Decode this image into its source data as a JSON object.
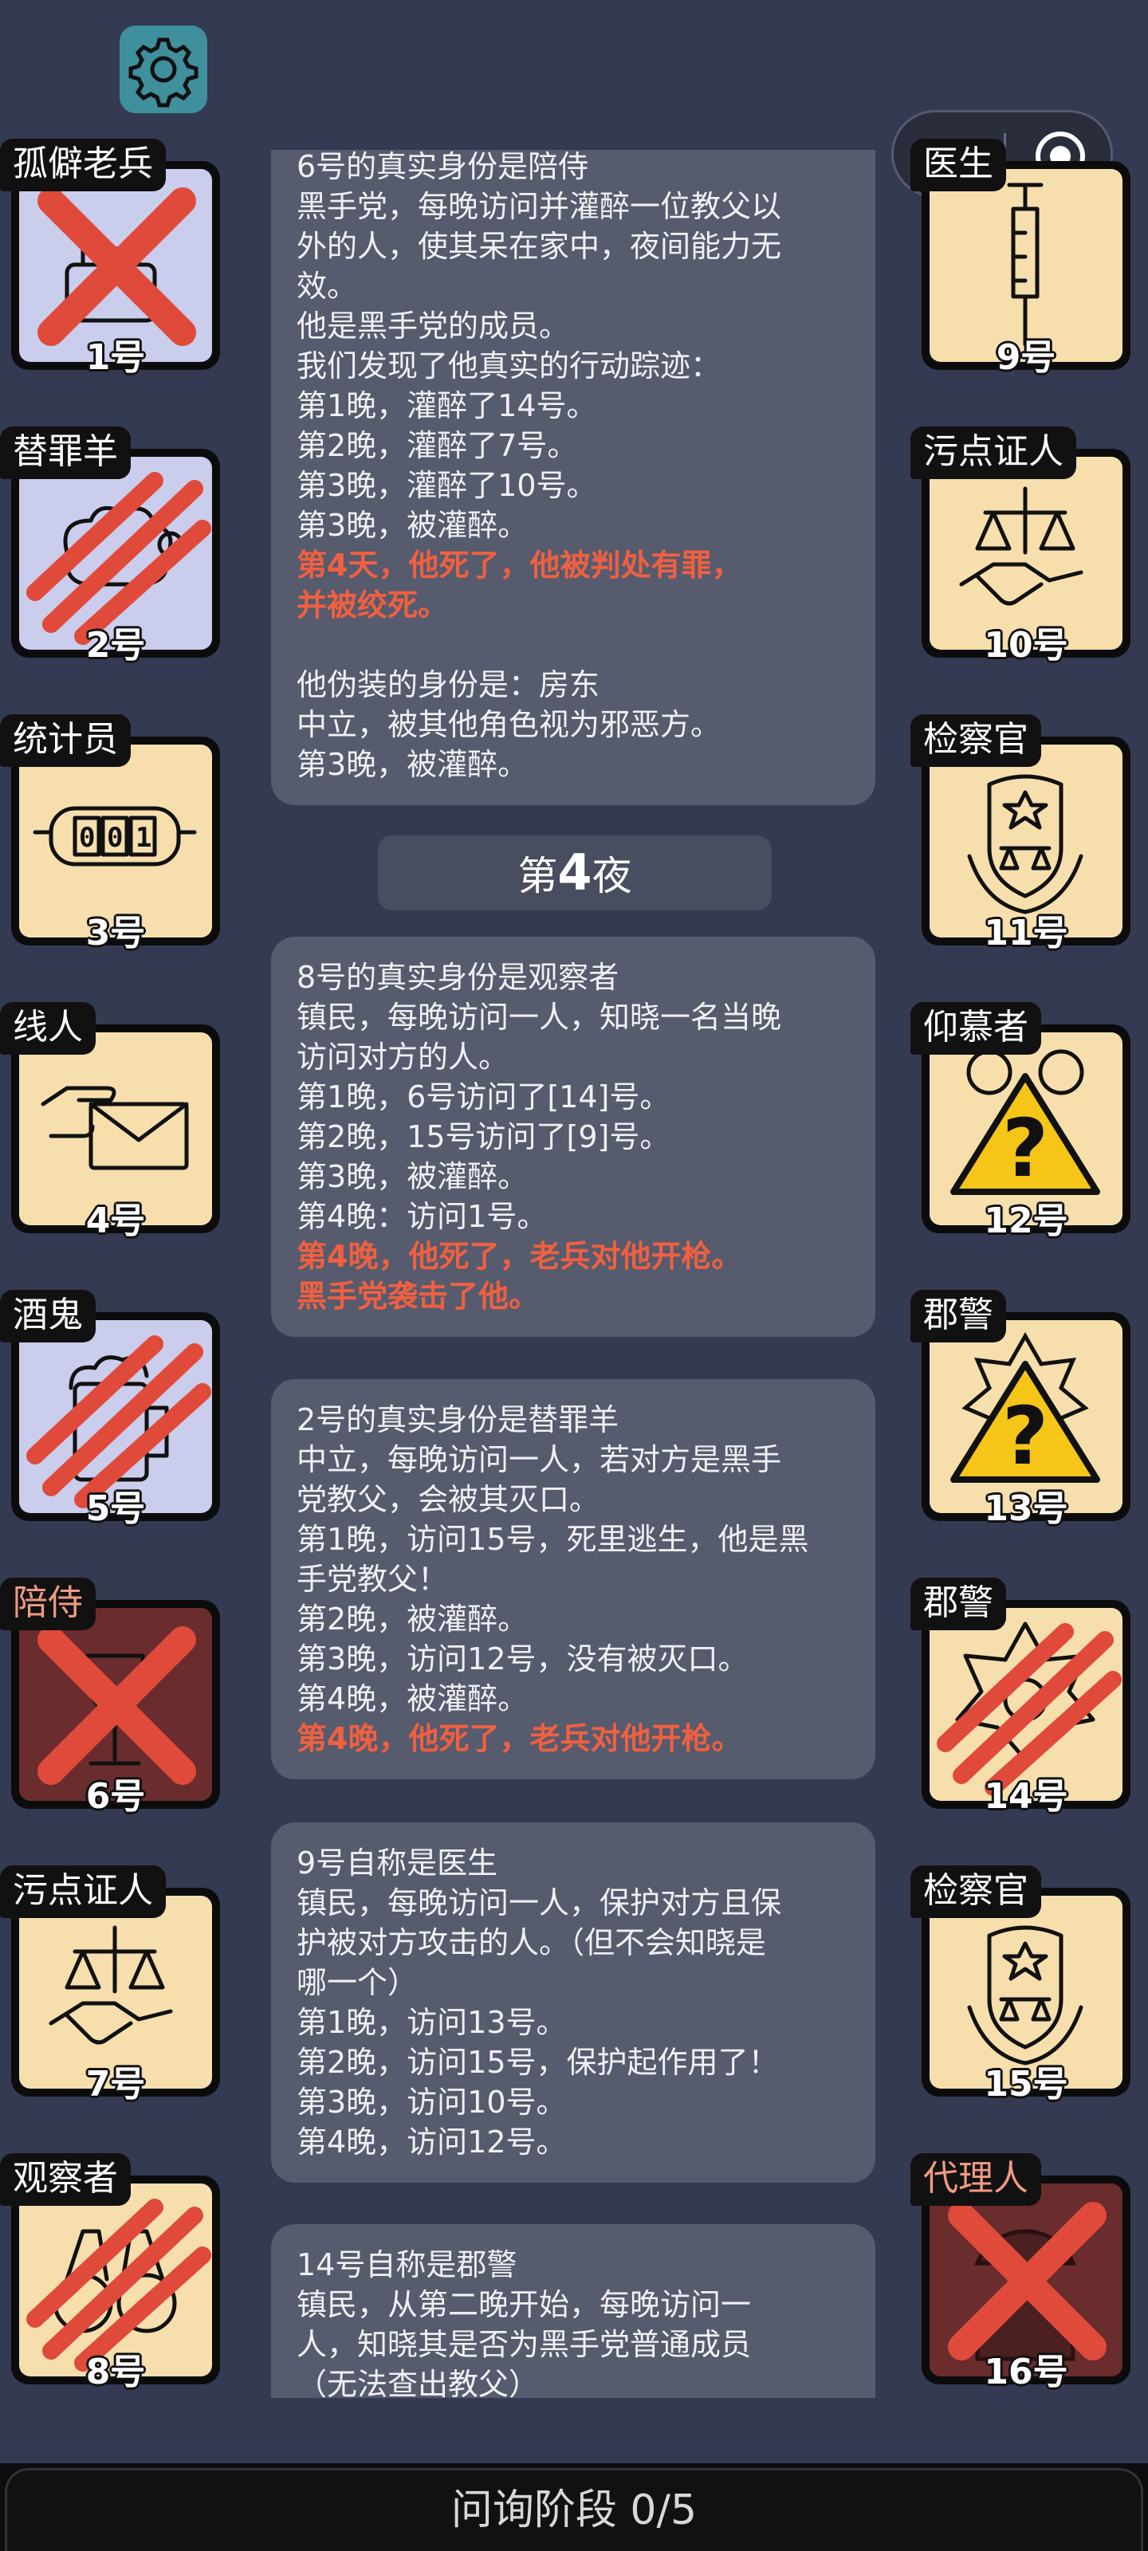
{
  "top": {
    "settings_icon": "gear-icon",
    "capsule": {
      "more_icon": "more-dots-icon",
      "close_icon": "target-icon"
    }
  },
  "players": [
    {
      "role": "孤僻老兵",
      "number": "1号",
      "icon": "veteran-icon",
      "bg": "lav",
      "mark": "x"
    },
    {
      "role": "替罪羊",
      "number": "2号",
      "icon": "sheep-icon",
      "bg": "lav",
      "mark": "claw"
    },
    {
      "role": "统计员",
      "number": "3号",
      "icon": "counter-icon",
      "bg": "yellow",
      "mark": "none"
    },
    {
      "role": "线人",
      "number": "4号",
      "icon": "envelope-hand-icon",
      "bg": "yellow",
      "mark": "none"
    },
    {
      "role": "酒鬼",
      "number": "5号",
      "icon": "beer-icon",
      "bg": "lav",
      "mark": "claw"
    },
    {
      "role": "陪侍",
      "number": "6号",
      "icon": "wine-glass-icon",
      "bg": "red",
      "mark": "x",
      "role_color": "pink"
    },
    {
      "role": "污点证人",
      "number": "7号",
      "icon": "scales-handshake-icon",
      "bg": "yellow",
      "mark": "none"
    },
    {
      "role": "观察者",
      "number": "8号",
      "icon": "binoculars-icon",
      "bg": "yellow",
      "mark": "claw"
    },
    {
      "role": "医生",
      "number": "9号",
      "icon": "syringe-icon",
      "bg": "yellow",
      "mark": "none"
    },
    {
      "role": "污点证人",
      "number": "10号",
      "icon": "scales-handshake-icon",
      "bg": "yellow",
      "mark": "none"
    },
    {
      "role": "检察官",
      "number": "11号",
      "icon": "prosecutor-badge-icon",
      "bg": "yellow",
      "mark": "none"
    },
    {
      "role": "仰慕者",
      "number": "12号",
      "icon": "warning-question-icon",
      "bg": "yellow",
      "mark": "none"
    },
    {
      "role": "郡警",
      "number": "13号",
      "icon": "sheriff-question-icon",
      "bg": "yellow",
      "mark": "none"
    },
    {
      "role": "郡警",
      "number": "14号",
      "icon": "sheriff-star-icon",
      "bg": "yellow",
      "mark": "claw"
    },
    {
      "role": "检察官",
      "number": "15号",
      "icon": "prosecutor-badge-icon",
      "bg": "yellow",
      "mark": "none"
    },
    {
      "role": "代理人",
      "number": "16号",
      "icon": "agent-icon",
      "bg": "red",
      "mark": "x",
      "role_color": "pink"
    }
  ],
  "log": {
    "entry1": {
      "lines": [
        "6号的真实身份是陪侍",
        "黑手党，每晚访问并灌醉一位教父以",
        "外的人，使其呆在家中，夜间能力无",
        "效。",
        "他是黑手党的成员。",
        "我们发现了他真实的行动踪迹：",
        "第1晚，灌醉了14号。",
        "第2晚，灌醉了7号。",
        "第3晚，灌醉了10号。",
        "第3晚，被灌醉。"
      ],
      "red": [
        "第4天，他死了，他被判处有罪，",
        "并被绞死。"
      ],
      "lines2": [
        "他伪装的身份是：房东",
        "中立，被其他角色视为邪恶方。",
        "第3晚，被灌醉。"
      ]
    },
    "night_prefix": "第",
    "night_number": "4",
    "night_suffix": "夜",
    "entry2": {
      "lines": [
        "8号的真实身份是观察者",
        "镇民，每晚访问一人，知晓一名当晚",
        "访问对方的人。",
        "第1晚，6号访问了[14]号。",
        "第2晚，15号访问了[9]号。",
        "第3晚，被灌醉。",
        "第4晚：访问1号。"
      ],
      "red": [
        "第4晚，他死了，老兵对他开枪。",
        "黑手党袭击了他。"
      ]
    },
    "entry3": {
      "lines": [
        "2号的真实身份是替罪羊",
        "中立，每晚访问一人，若对方是黑手",
        "党教父，会被其灭口。",
        "第1晚，访问15号，死里逃生，他是黑",
        "手党教父！",
        "第2晚，被灌醉。",
        "第3晚，访问12号，没有被灭口。",
        "第4晚，被灌醉。"
      ],
      "red": [
        "第4晚，他死了，老兵对他开枪。"
      ]
    },
    "entry4": {
      "lines": [
        "9号自称是医生",
        "镇民，每晚访问一人，保护对方且保",
        "护被对方攻击的人。（但不会知晓是",
        "哪一个）",
        "第1晚，访问13号。",
        "第2晚，访问15号，保护起作用了！",
        "第3晚，访问10号。",
        "第4晚，访问12号。"
      ]
    },
    "entry5": {
      "lines": [
        "14号自称是郡警",
        "镇民，从第二晚开始，每晚访问一",
        "人，知晓其是否为黑手党普通成员",
        "（无法查出教父）"
      ]
    }
  },
  "bottom_bar": {
    "label": "问询阶段 0/5"
  },
  "colors": {
    "bg": "#343a52",
    "card_yellow": "#f6dfad",
    "card_lavender": "#cacdec",
    "card_dead": "#6a2c2c",
    "death_text": "#f06040"
  }
}
